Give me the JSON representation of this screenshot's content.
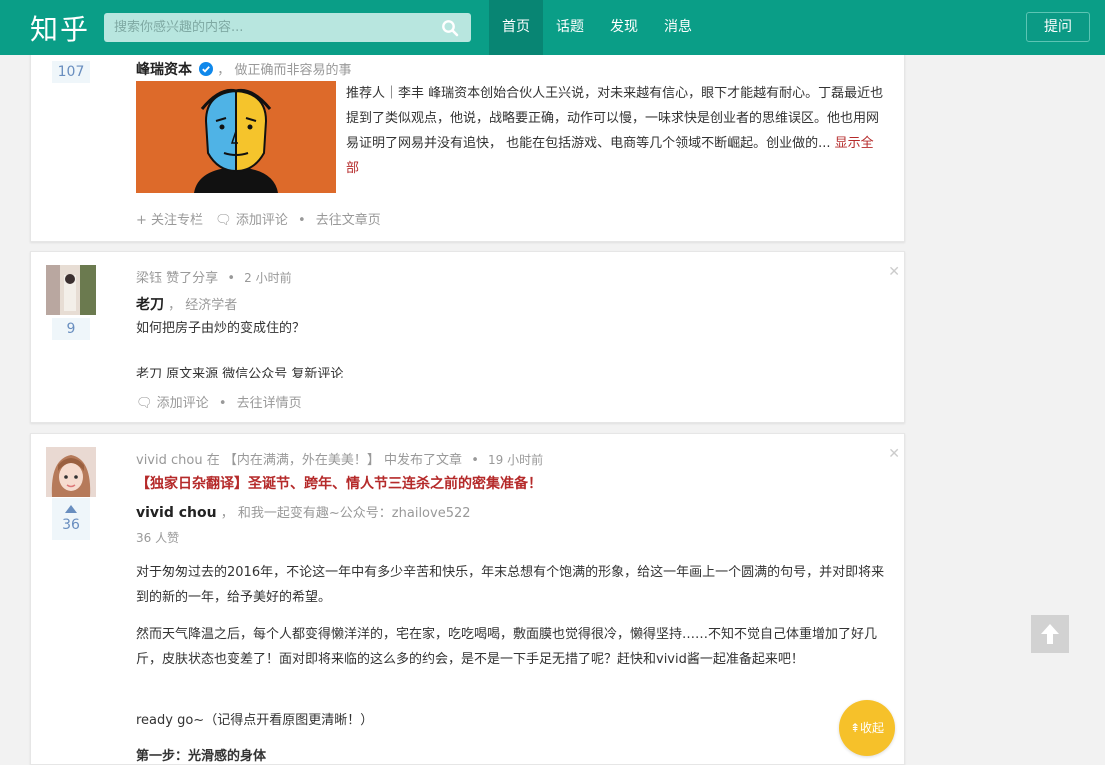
{
  "header": {
    "logo": "知乎",
    "search_placeholder": "搜索你感兴趣的内容...",
    "nav": [
      "首页",
      "话题",
      "发现",
      "消息"
    ],
    "ask": "提问"
  },
  "card1": {
    "votes": "107",
    "author": "峰瑞资本",
    "author_bio": "做正确而非容易的事",
    "excerpt": "推荐人｜李丰 峰瑞资本创始合伙人王兴说，对未来越有信心，眼下才能越有耐心。丁磊最近也提到了类似观点，他说，战略要正确，动作可以慢，一味求快是创业者的思维误区。他也用网易证明了网易并没有追快， 也能在包括游戏、电商等几个领域不断崛起。创业做的...",
    "show_all": "显示全部",
    "actions": [
      "+ 关注专栏",
      "添加评论",
      "去往文章页"
    ]
  },
  "card2": {
    "votes": "9",
    "actor": "梁钰",
    "action": "赞了分享",
    "time": "2 小时前",
    "author": "老刀",
    "author_bio": "经济学者",
    "question": "如何把房子由炒的变成住的？",
    "preview_cut": "老刀    原文来源    微信公众号 复新评论",
    "actions": [
      "添加评论",
      "去往详情页"
    ]
  },
  "card3": {
    "votes": "36",
    "actor": "vivid chou",
    "action_prefix": "在",
    "column": "【内在满满，外在美美！】",
    "action_suffix": "中发布了文章",
    "time": "19 小时前",
    "title": "【独家日杂翻译】圣诞节、跨年、情人节三连杀之前的密集准备！",
    "author": "vivid chou",
    "author_bio": "和我一起变有趣~公众号：zhailove522",
    "likes": "36 人赞",
    "para1": "对于匆匆过去的2016年，不论这一年中有多少辛苦和快乐，年末总想有个饱满的形象，给这一年画上一个圆满的句号，并对即将来到的新的一年，给予美好的希望。",
    "para2": "然而天气降温之后，每个人都变得懒洋洋的，宅在家，吃吃喝喝，敷面膜也觉得很冷，懒得坚持……不知不觉自己体重增加了好几斤，皮肤状态也变差了！面对即将来临的这么多的约会，是不是一下手足无措了呢？赶快和vivid酱一起准备起来吧！",
    "para3": "ready go~（记得点开看原图更清晰！）",
    "para4_cut": "第一步：光滑感的身体"
  },
  "floating": {
    "collapse": "收起"
  },
  "colors": {
    "brand": "#0a9e87",
    "link_red": "#b52a2a",
    "vote_blue": "#698ebf",
    "collapse_yellow": "#f6c12a"
  }
}
